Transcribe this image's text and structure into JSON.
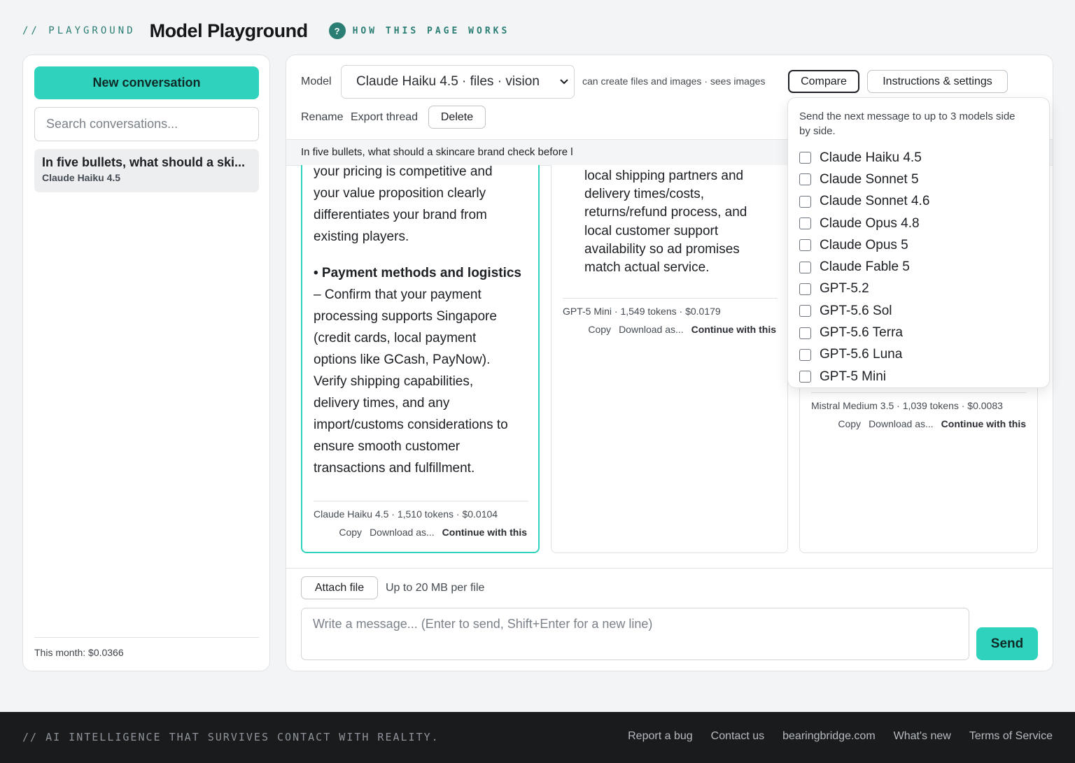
{
  "header": {
    "eyebrow": "// PLAYGROUND",
    "title": "Model Playground",
    "help_icon": "?",
    "how_link": "HOW THIS PAGE WORKS"
  },
  "sidebar": {
    "new_conversation": "New conversation",
    "search_placeholder": "Search conversations...",
    "conversations": [
      {
        "title": "In five bullets, what should a ski...",
        "model": "Claude Haiku 4.5"
      }
    ],
    "month_total": "This month: $0.0366"
  },
  "toolbar": {
    "model_label": "Model",
    "model_selected": "Claude Haiku 4.5 · files · vision",
    "capabilities": "can create files and images · sees images",
    "compare": "Compare",
    "instructions": "Instructions & settings",
    "rename": "Rename",
    "export": "Export thread",
    "delete": "Delete"
  },
  "prompt": "In five bullets, what should a skincare brand check before l",
  "responses": [
    {
      "lines_top": [
        "your pricing is competitive and",
        "your value proposition clearly",
        "differentiates your brand from",
        "existing players."
      ],
      "bullet_heading": "• Payment methods and logistics",
      "lines_bottom": [
        "– Confirm that your payment",
        "processing supports Singapore",
        "(credit cards, local payment",
        "options like GCash, PayNow).",
        "Verify shipping capabilities,",
        "delivery times, and any",
        "import/customs considerations to",
        "ensure smooth customer",
        "transactions and fulfillment."
      ],
      "meta": "Claude Haiku 4.5 · 1,510 tokens · $0.0104",
      "copy": "Copy",
      "download": "Download as...",
      "continue": "Continue with this"
    },
    {
      "lines": [
        "local shipping partners and",
        "delivery times/costs,",
        "returns/refund process, and",
        "local customer support",
        "availability so ad promises",
        "match actual service."
      ],
      "meta": "GPT-5 Mini · 1,549 tokens · $0.0179",
      "copy": "Copy",
      "download": "Download as...",
      "continue": "Continue with this"
    },
    {
      "meta": "Mistral Medium 3.5 · 1,039 tokens · $0.0083",
      "copy": "Copy",
      "download": "Download as...",
      "continue": "Continue with this"
    }
  ],
  "compare_menu": {
    "description": "Send the next message to up to 3 models side by side.",
    "models": [
      "Claude Haiku 4.5",
      "Claude Sonnet 5",
      "Claude Sonnet 4.6",
      "Claude Opus 4.8",
      "Claude Opus 5",
      "Claude Fable 5",
      "GPT-5.2",
      "GPT-5.6 Sol",
      "GPT-5.6 Terra",
      "GPT-5.6 Luna",
      "GPT-5 Mini"
    ]
  },
  "composer": {
    "attach": "Attach file",
    "attach_note": "Up to 20 MB per file",
    "placeholder": "Write a message... (Enter to send, Shift+Enter for a new line)",
    "send": "Send"
  },
  "footer": {
    "tagline": "// AI INTELLIGENCE THAT SURVIVES CONTACT WITH REALITY.",
    "links": [
      "Report a bug",
      "Contact us",
      "bearingbridge.com",
      "What's new",
      "Terms of Service"
    ]
  },
  "colors": {
    "accent": "#2fd3bd",
    "brand_teal": "#2a7e74",
    "footer_bg": "#1a1b1d"
  }
}
